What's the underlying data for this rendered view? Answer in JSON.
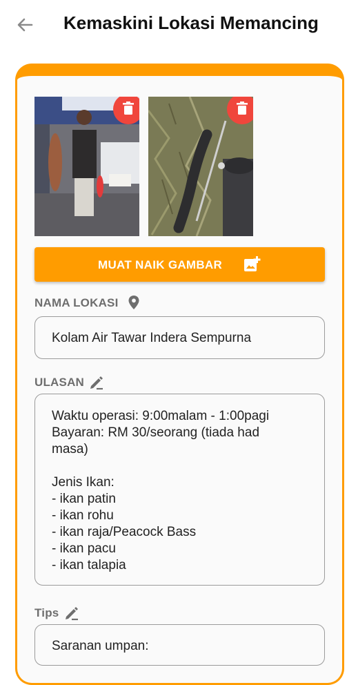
{
  "header": {
    "title": "Kemaskini Lokasi Memancing",
    "back_icon": "arrow-left-icon"
  },
  "photos": [
    {
      "name": "photo-angler-holding-fish",
      "delete_icon": "trash-icon"
    },
    {
      "name": "photo-catfish-on-grass",
      "delete_icon": "trash-icon"
    }
  ],
  "upload_button": {
    "label": "MUAT NAIK GAMBAR",
    "icon": "add-photo-icon"
  },
  "location": {
    "label": "NAMA LOKASI",
    "icon": "location-pin-icon",
    "value": "Kolam Air Tawar Indera Sempurna"
  },
  "review": {
    "label": "ULASAN",
    "icon": "edit-pencil-icon",
    "value": "Waktu operasi: 9:00malam - 1:00pagi\nBayaran: RM 30/seorang (tiada had\nmasa)\n\nJenis Ikan:\n- ikan patin\n- ikan rohu\n- ikan raja/Peacock Bass\n- ikan pacu\n- ikan talapia"
  },
  "tips": {
    "label": "Tips",
    "icon": "edit-pencil-icon",
    "value": "Saranan umpan:"
  },
  "colors": {
    "accent": "#ff9c00",
    "delete": "#f0463c",
    "label_gray": "#6e6e6e"
  }
}
